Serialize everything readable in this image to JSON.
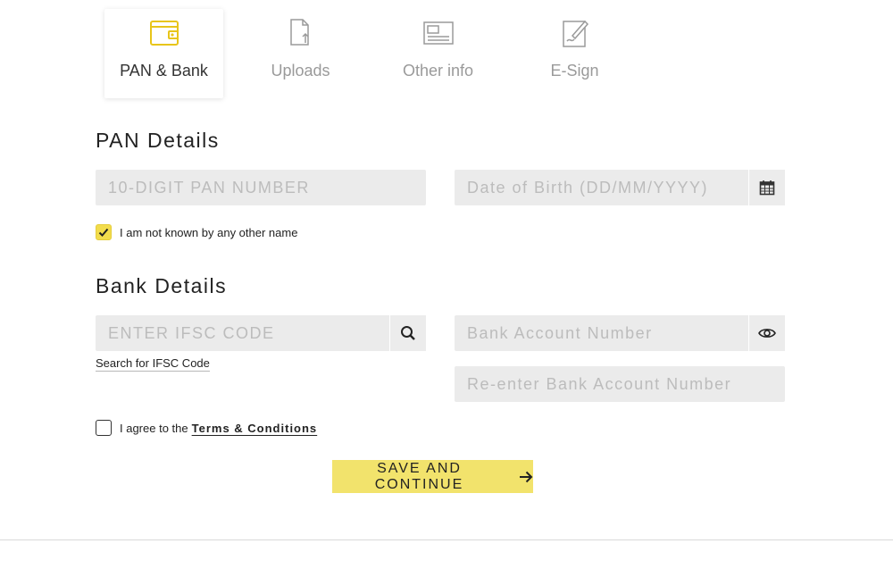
{
  "tabs": [
    {
      "label": "PAN & Bank",
      "icon": "wallet-icon",
      "active": true
    },
    {
      "label": "Uploads",
      "icon": "upload-document-icon",
      "active": false
    },
    {
      "label": "Other info",
      "icon": "form-document-icon",
      "active": false
    },
    {
      "label": "E-Sign",
      "icon": "signature-icon",
      "active": false
    }
  ],
  "pan_section": {
    "title": "PAN Details",
    "pan_placeholder": "10-DIGIT PAN NUMBER",
    "dob_placeholder": "Date of Birth (DD/MM/YYYY)",
    "other_name_label": "I am not known by any other name",
    "other_name_checked": true
  },
  "bank_section": {
    "title": "Bank Details",
    "ifsc_placeholder": "ENTER IFSC CODE",
    "ifsc_search_link": "Search for IFSC Code",
    "account_placeholder": "Bank Account Number",
    "reenter_placeholder": "Re-enter Bank Account Number"
  },
  "terms": {
    "prefix": "I agree to the",
    "link": "Terms & Conditions",
    "checked": false
  },
  "save_button": {
    "label": "SAVE AND CONTINUE"
  },
  "colors": {
    "accent": "#f2e36c",
    "checkbox_accent": "#f2dc4c",
    "field_bg": "#ebebeb"
  }
}
